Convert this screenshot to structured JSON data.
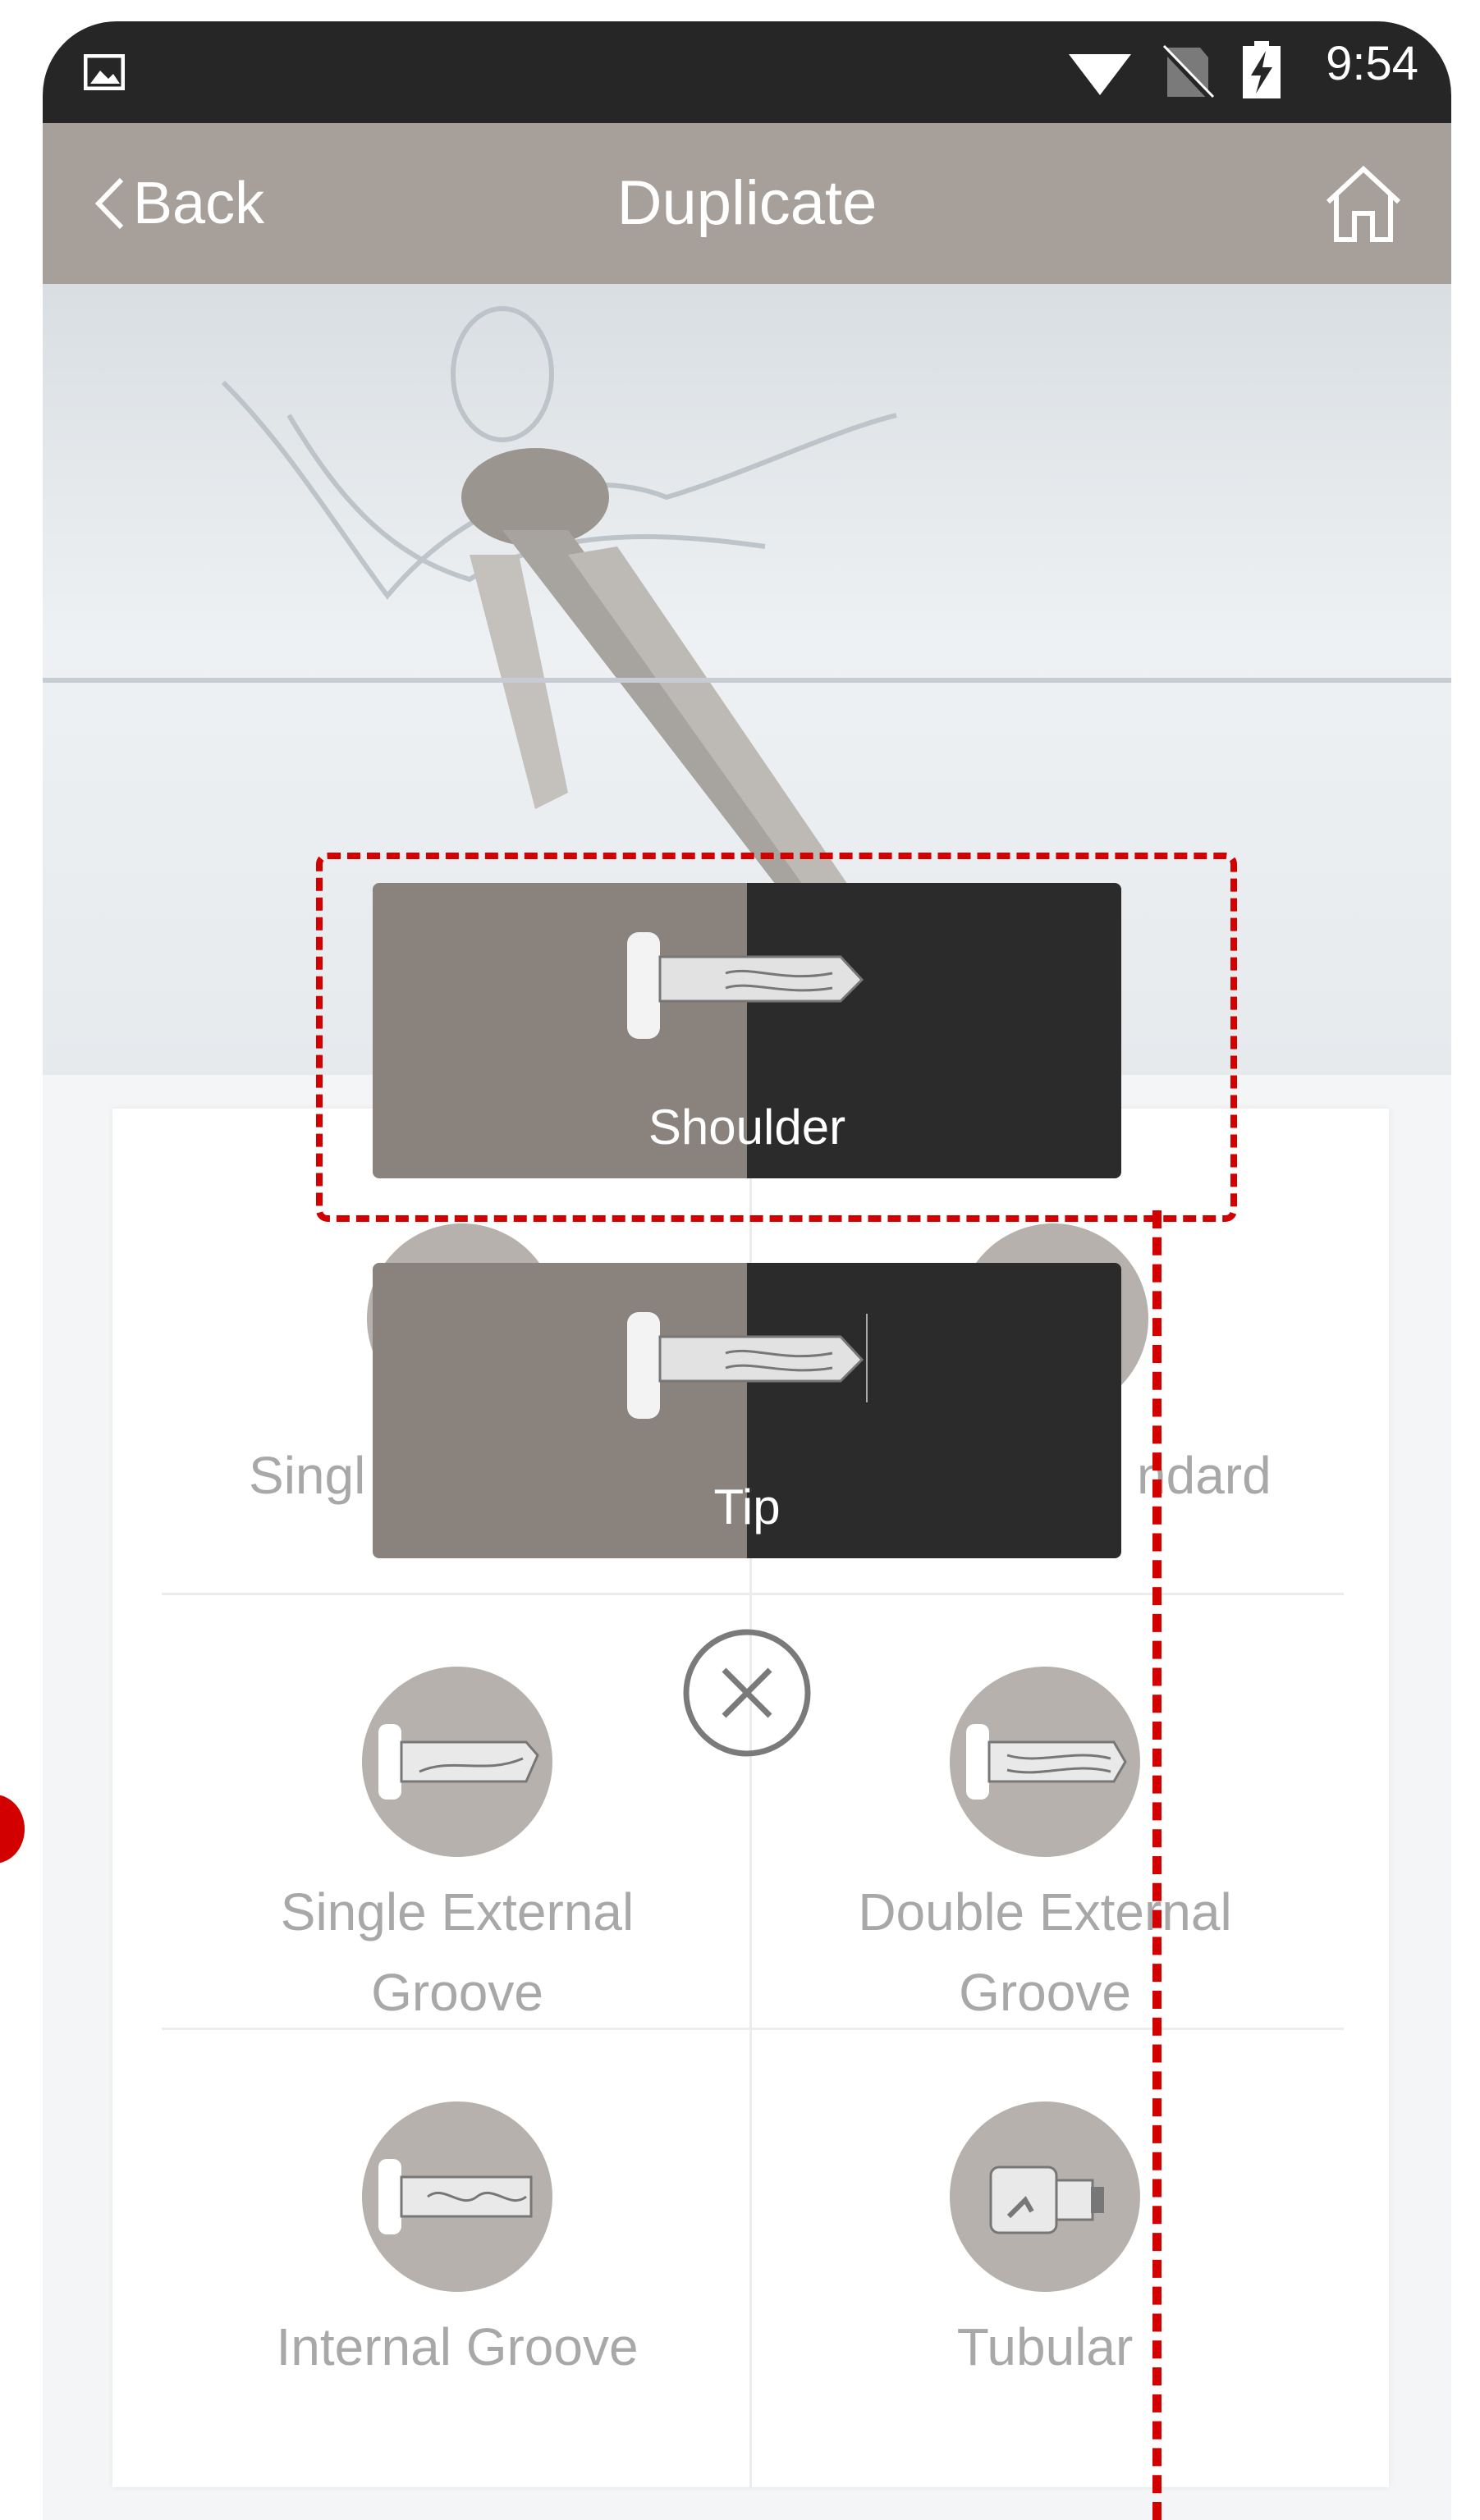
{
  "status_bar": {
    "time": "9:54"
  },
  "nav": {
    "back_label": "Back",
    "title": "Duplicate"
  },
  "grid": {
    "row1": {
      "left_partial": "Singl",
      "right_partial": "ndard"
    },
    "items": [
      {
        "label": "Single External\nGroove",
        "icon": "single-external-groove-key-icon"
      },
      {
        "label": "Double External\nGroove",
        "icon": "double-external-groove-key-icon"
      },
      {
        "label": "Internal Groove",
        "icon": "internal-groove-key-icon"
      },
      {
        "label": "Tubular",
        "icon": "tubular-key-icon"
      }
    ]
  },
  "popup": {
    "options": [
      {
        "label": "Shoulder"
      },
      {
        "label": "Tip"
      }
    ]
  },
  "colors": {
    "accent": "#a79f99",
    "annotation": "#d30000",
    "status_bar": "#262626"
  }
}
